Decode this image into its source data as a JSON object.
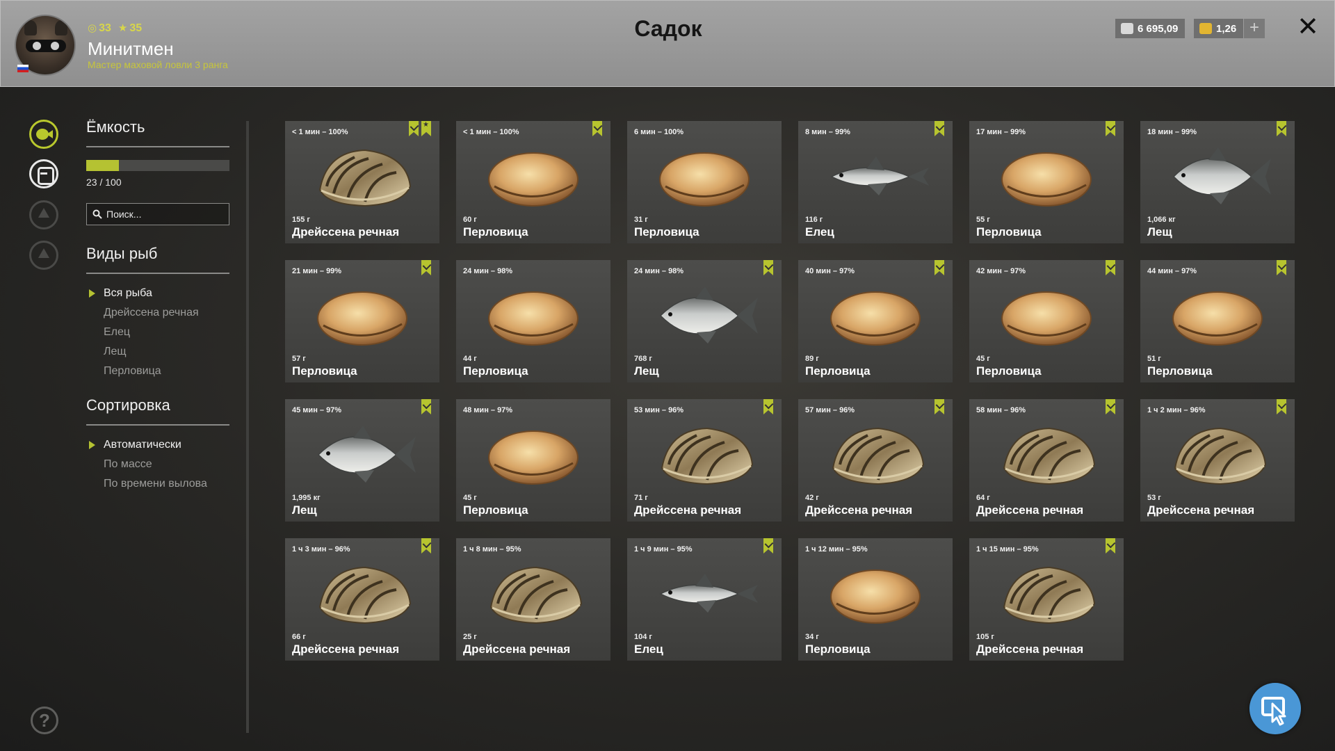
{
  "header": {
    "level": "33",
    "rating": "35",
    "player_name": "Минитмен",
    "player_rank": "Мастер маховой ловли 3 ранга",
    "title": "Садок",
    "silver": "6 695,09",
    "gold": "1,26",
    "plus_label": "+",
    "close_label": "✕"
  },
  "sidebar": {
    "capacity_title": "Ёмкость",
    "capacity_text": "23 / 100",
    "capacity_fraction": 0.23,
    "search_placeholder": "Поиск...",
    "species_title": "Виды рыб",
    "species": [
      "Вся рыба",
      "Дрейссена речная",
      "Елец",
      "Лещ",
      "Перловица"
    ],
    "sort_title": "Сортировка",
    "sort": [
      "Автоматически",
      "По массе",
      "По времени вылова"
    ],
    "help_label": "?"
  },
  "colors": {
    "accent": "#b7c42f",
    "cursor_button": "#4a97d6"
  },
  "catches": [
    {
      "time": "< 1 мин – 100%",
      "weight": "155 г",
      "name": "Дрейссена речная",
      "kind": "mussel",
      "star": true
    },
    {
      "time": "< 1 мин – 100%",
      "weight": "60 г",
      "name": "Перловица",
      "kind": "clam",
      "star": false
    },
    {
      "time": "6 мин – 100%",
      "weight": "31 г",
      "name": "Перловица",
      "kind": "clam",
      "star": false,
      "nomark": true
    },
    {
      "time": "8 мин – 99%",
      "weight": "116 г",
      "name": "Елец",
      "kind": "slimfish",
      "star": false
    },
    {
      "time": "17 мин – 99%",
      "weight": "55 г",
      "name": "Перловица",
      "kind": "clam",
      "star": false
    },
    {
      "time": "18 мин – 99%",
      "weight": "1,066 кг",
      "name": "Лещ",
      "kind": "fish",
      "star": false
    },
    {
      "time": "21 мин – 99%",
      "weight": "57 г",
      "name": "Перловица",
      "kind": "clam",
      "star": false
    },
    {
      "time": "24 мин – 98%",
      "weight": "44 г",
      "name": "Перловица",
      "kind": "clam",
      "star": false,
      "nomark": true
    },
    {
      "time": "24 мин – 98%",
      "weight": "768 г",
      "name": "Лещ",
      "kind": "fish",
      "star": false
    },
    {
      "time": "40 мин – 97%",
      "weight": "89 г",
      "name": "Перловица",
      "kind": "clam",
      "star": false
    },
    {
      "time": "42 мин – 97%",
      "weight": "45 г",
      "name": "Перловица",
      "kind": "clam",
      "star": false
    },
    {
      "time": "44 мин – 97%",
      "weight": "51 г",
      "name": "Перловица",
      "kind": "clam",
      "star": false
    },
    {
      "time": "45 мин – 97%",
      "weight": "1,995 кг",
      "name": "Лещ",
      "kind": "fish",
      "star": false
    },
    {
      "time": "48 мин – 97%",
      "weight": "45 г",
      "name": "Перловица",
      "kind": "clam",
      "star": false,
      "nomark": true
    },
    {
      "time": "53 мин – 96%",
      "weight": "71 г",
      "name": "Дрейссена речная",
      "kind": "mussel",
      "star": false
    },
    {
      "time": "57 мин – 96%",
      "weight": "42 г",
      "name": "Дрейссена речная",
      "kind": "mussel",
      "star": false
    },
    {
      "time": "58 мин – 96%",
      "weight": "64 г",
      "name": "Дрейссена речная",
      "kind": "mussel",
      "star": false
    },
    {
      "time": "1 ч 2 мин – 96%",
      "weight": "53 г",
      "name": "Дрейссена речная",
      "kind": "mussel",
      "star": false
    },
    {
      "time": "1 ч 3 мин – 96%",
      "weight": "66 г",
      "name": "Дрейссена речная",
      "kind": "mussel",
      "star": false
    },
    {
      "time": "1 ч 8 мин – 95%",
      "weight": "25 г",
      "name": "Дрейссена речная",
      "kind": "mussel",
      "star": false,
      "nomark": true
    },
    {
      "time": "1 ч 9 мин – 95%",
      "weight": "104 г",
      "name": "Елец",
      "kind": "slimfish",
      "star": false
    },
    {
      "time": "1 ч 12 мин – 95%",
      "weight": "34 г",
      "name": "Перловица",
      "kind": "clam",
      "star": false,
      "nomark": true
    },
    {
      "time": "1 ч 15 мин – 95%",
      "weight": "105 г",
      "name": "Дрейссена речная",
      "kind": "mussel",
      "star": false
    }
  ]
}
